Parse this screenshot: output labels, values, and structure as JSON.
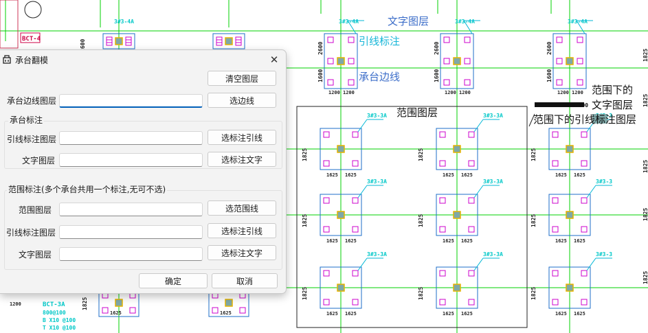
{
  "drawing": {
    "annotations": {
      "text_layer": "文字图层",
      "leader_label": "引线标注",
      "cap_edge": "承台边线",
      "range_layer": "范围图层",
      "range_text_layer_line1": "范围下的",
      "range_text_layer_line2": "文字图层",
      "range_leader_layer": "范围下的引线标注图层"
    },
    "tags": {
      "top_tags": [
        "3#3-4A",
        "3#3-4A",
        "3#3-4A",
        "3#3-4"
      ],
      "grid_tags": [
        "3#3-3A",
        "3#3-3A",
        "3#3-3",
        "3#3-3A",
        "3#3-3A",
        "3#3-3",
        "3#3-3A",
        "3#3-3A",
        "3#3-3"
      ],
      "dim_1200": "1200",
      "dim_1625": "1625",
      "dim_1825": "1825",
      "dim_2600": "2600",
      "dim_1600": "1600",
      "elev": "5.600",
      "left_tag": "BCT-4",
      "bottom_tag": "BCT-3A",
      "bottom_l2": "800@100",
      "bottom_l3": "B X10 @100",
      "bottom_l4": "T X10 @100",
      "bottom_l5": "B:X10 n12@100"
    },
    "colors": {
      "grid": "#00d200",
      "outline": "#1e6ec8",
      "pile": "#cc00cc",
      "text": "#00c8c8",
      "leader": "#00b7d6",
      "center": "#e6b400"
    }
  },
  "dialog": {
    "title": "承台翻模",
    "clear_layer_btn": "清空图层",
    "cap_edge_label": "承台边线图层",
    "cap_edge_value": "",
    "select_edge_btn": "选边线",
    "cap_mark_group": "承台标注",
    "leader_layer_label": "引线标注图层",
    "leader_layer_value": "",
    "select_leader_btn": "选标注引线",
    "text_layer_label": "文字图层",
    "text_layer_value": "",
    "select_text_btn": "选标注文字",
    "range_group": "范围标注(多个承台共用一个标注,无可不选)",
    "range_layer_label": "范围图层",
    "range_layer_value": "",
    "select_range_btn": "选范围线",
    "range_leader_label": "引线标注图层",
    "range_leader_value": "",
    "range_select_leader_btn": "选标注引线",
    "range_text_label": "文字图层",
    "range_text_value": "",
    "range_select_text_btn": "选标注文字",
    "ok_btn": "确定",
    "cancel_btn": "取消"
  }
}
